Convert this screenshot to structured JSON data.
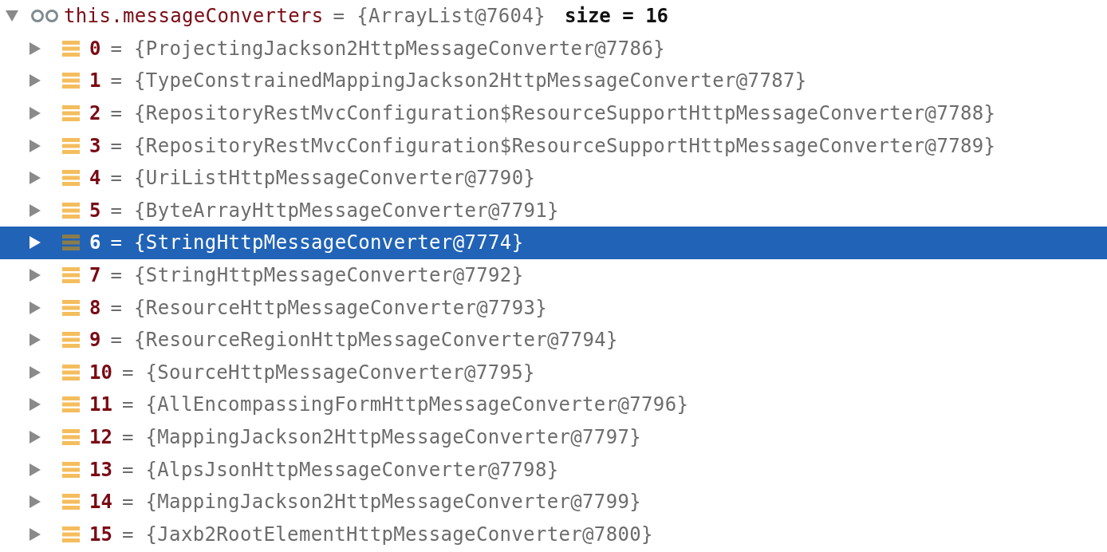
{
  "tree": {
    "name": "this.messageConverters",
    "value": "= {ArrayList@7604}",
    "size": "size = 16",
    "expanded": true,
    "selected": false,
    "children": [
      {
        "index": "0",
        "value": "= {ProjectingJackson2HttpMessageConverter@7786}",
        "expanded": false,
        "selected": false
      },
      {
        "index": "1",
        "value": "= {TypeConstrainedMappingJackson2HttpMessageConverter@7787}",
        "expanded": false,
        "selected": false
      },
      {
        "index": "2",
        "value": "= {RepositoryRestMvcConfiguration$ResourceSupportHttpMessageConverter@7788}",
        "expanded": false,
        "selected": false
      },
      {
        "index": "3",
        "value": "= {RepositoryRestMvcConfiguration$ResourceSupportHttpMessageConverter@7789}",
        "expanded": false,
        "selected": false
      },
      {
        "index": "4",
        "value": "= {UriListHttpMessageConverter@7790}",
        "expanded": false,
        "selected": false
      },
      {
        "index": "5",
        "value": "= {ByteArrayHttpMessageConverter@7791}",
        "expanded": false,
        "selected": false
      },
      {
        "index": "6",
        "value": "= {StringHttpMessageConverter@7774}",
        "expanded": false,
        "selected": true
      },
      {
        "index": "7",
        "value": "= {StringHttpMessageConverter@7792}",
        "expanded": false,
        "selected": false
      },
      {
        "index": "8",
        "value": "= {ResourceHttpMessageConverter@7793}",
        "expanded": false,
        "selected": false
      },
      {
        "index": "9",
        "value": "= {ResourceRegionHttpMessageConverter@7794}",
        "expanded": false,
        "selected": false
      },
      {
        "index": "10",
        "value": "= {SourceHttpMessageConverter@7795}",
        "expanded": false,
        "selected": false
      },
      {
        "index": "11",
        "value": "= {AllEncompassingFormHttpMessageConverter@7796}",
        "expanded": false,
        "selected": false
      },
      {
        "index": "12",
        "value": "= {MappingJackson2HttpMessageConverter@7797}",
        "expanded": false,
        "selected": false
      },
      {
        "index": "13",
        "value": "= {AlpsJsonHttpMessageConverter@7798}",
        "expanded": false,
        "selected": false
      },
      {
        "index": "14",
        "value": "= {MappingJackson2HttpMessageConverter@7799}",
        "expanded": false,
        "selected": false
      },
      {
        "index": "15",
        "value": "= {Jaxb2RootElementHttpMessageConverter@7800}",
        "expanded": false,
        "selected": false
      }
    ]
  }
}
